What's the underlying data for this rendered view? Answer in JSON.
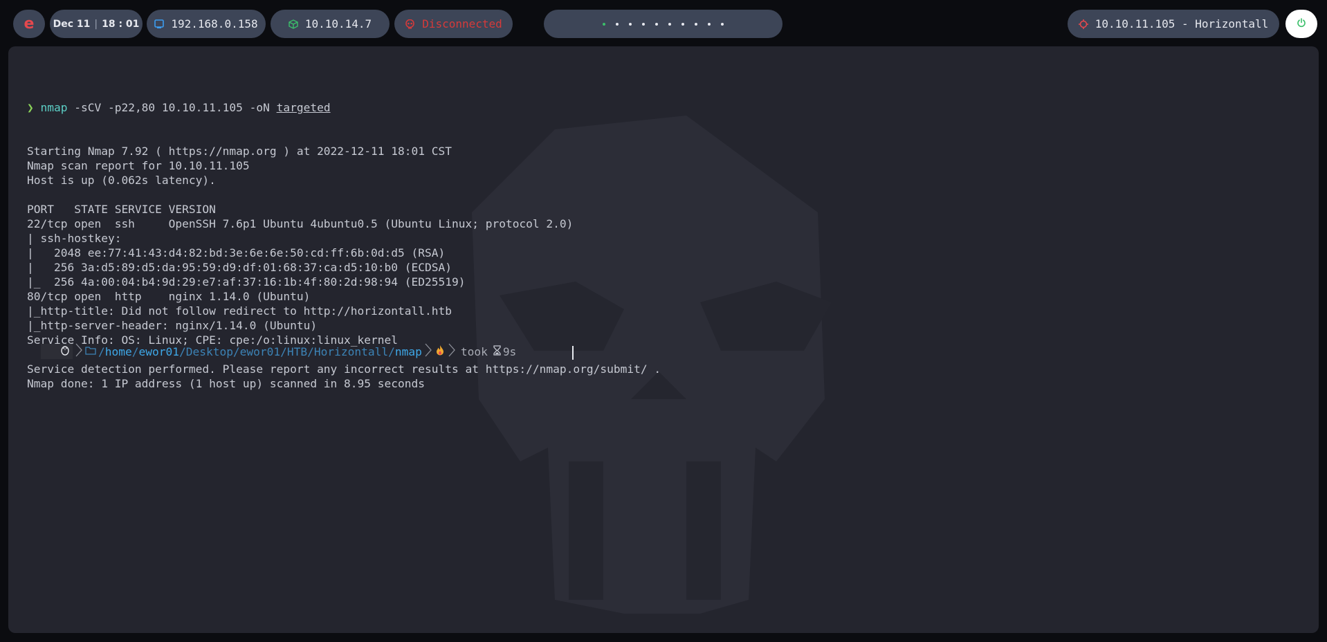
{
  "topbar": {
    "logo": "e",
    "date": "Dec 11",
    "time_sep": "|",
    "time": "18 : 01",
    "local_ip": "192.168.0.158",
    "vpn_ip": "10.10.14.7",
    "status": "Disconnected",
    "target": "10.10.11.105 - Horizontall",
    "workspace_count": 10,
    "active_workspace": 1
  },
  "terminal": {
    "prompt_symbol": "❯",
    "command_bin": "nmap",
    "command_args": " -sCV -p22,80 10.10.11.105 -oN ",
    "command_file": "targeted",
    "output": [
      "Starting Nmap 7.92 ( https://nmap.org ) at 2022-12-11 18:01 CST",
      "Nmap scan report for 10.10.11.105",
      "Host is up (0.062s latency).",
      "",
      "PORT   STATE SERVICE VERSION",
      "22/tcp open  ssh     OpenSSH 7.6p1 Ubuntu 4ubuntu0.5 (Ubuntu Linux; protocol 2.0)",
      "| ssh-hostkey: ",
      "|   2048 ee:77:41:43:d4:82:bd:3e:6e:6e:50:cd:ff:6b:0d:d5 (RSA)",
      "|   256 3a:d5:89:d5:da:95:59:d9:df:01:68:37:ca:d5:10:b0 (ECDSA)",
      "|_  256 4a:00:04:b4:9d:29:e7:af:37:16:1b:4f:80:2d:98:94 (ED25519)",
      "80/tcp open  http    nginx 1.14.0 (Ubuntu)",
      "|_http-title: Did not follow redirect to http://horizontall.htb",
      "|_http-server-header: nginx/1.14.0 (Ubuntu)",
      "Service Info: OS: Linux; CPE: cpe:/o:linux:linux_kernel",
      "",
      "Service detection performed. Please report any incorrect results at https://nmap.org/submit/ .",
      "Nmap done: 1 IP address (1 host up) scanned in 8.95 seconds"
    ],
    "prompt": {
      "path_parts": [
        {
          "text": "/",
          "bright": false
        },
        {
          "text": "home",
          "bright": true
        },
        {
          "text": "/",
          "bright": false
        },
        {
          "text": "ewor01",
          "bright": true
        },
        {
          "text": "/Desktop/ewor01/HTB/Horizontall/",
          "bright": false
        },
        {
          "text": "nmap",
          "bright": true
        }
      ],
      "took_label": "took",
      "took_value": "9s"
    }
  },
  "colors": {
    "accent_red": "#e5484d",
    "ok_green": "#3bbf6a",
    "ip_blue": "#3d9df0",
    "terminal_bg": "#24252e"
  }
}
